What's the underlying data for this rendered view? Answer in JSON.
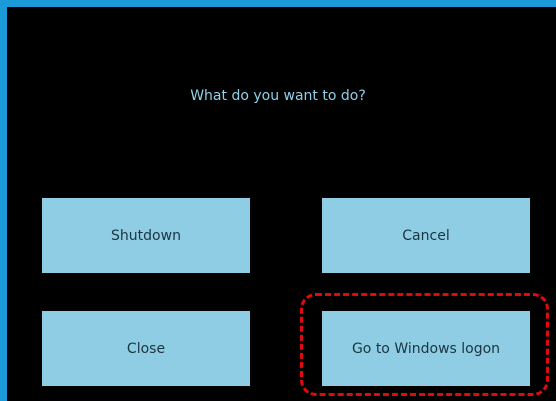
{
  "dialog": {
    "prompt": "What do you want to do?"
  },
  "buttons": {
    "shutdown": "Shutdown",
    "cancel": "Cancel",
    "close": "Close",
    "go_to_logon": "Go to Windows logon"
  },
  "colors": {
    "frame_border": "#1b9ad8",
    "background": "#000000",
    "button_fill": "#8ecde4",
    "prompt_text": "#8fd0ea",
    "highlight": "#e10a0a"
  }
}
